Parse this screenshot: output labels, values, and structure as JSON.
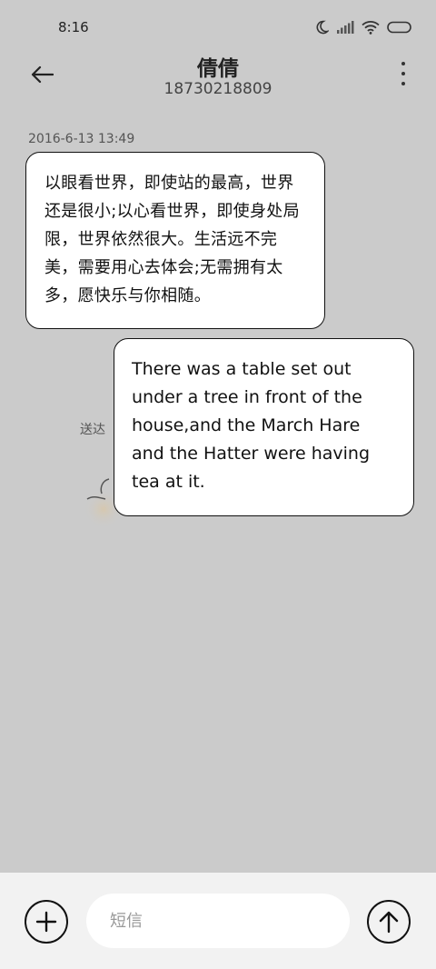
{
  "status_bar": {
    "time": "8:16",
    "icons": [
      "moon-icon",
      "signal-icon",
      "wifi-icon",
      "battery-icon"
    ]
  },
  "header": {
    "contact_name": "倩倩",
    "contact_number": "18730218809",
    "icons": [
      "back-arrow-icon",
      "more-vertical-icon"
    ]
  },
  "conversation": {
    "timestamp": "2016-6-13 13:49",
    "messages": [
      {
        "direction": "incoming",
        "text": "以眼看世界，即使站的最高，世界还是很小;以心看世界，即使身处局限，世界依然很大。生活远不完美，需要用心去体会;无需拥有太多，愿快乐与你相随。"
      },
      {
        "direction": "outgoing",
        "text": "There was a table set out under a tree in front of the house,and the March Hare and the Hatter were having tea at it."
      }
    ],
    "sent_status": "送达"
  },
  "composer": {
    "placeholder": "短信",
    "value": "",
    "icons": [
      "add-icon",
      "send-arrow-up-icon"
    ]
  },
  "colors": {
    "background": "#cbcbcb",
    "bubble": "#ffffff",
    "composer_bar": "#f2f2f2",
    "input": "#ffffff"
  }
}
